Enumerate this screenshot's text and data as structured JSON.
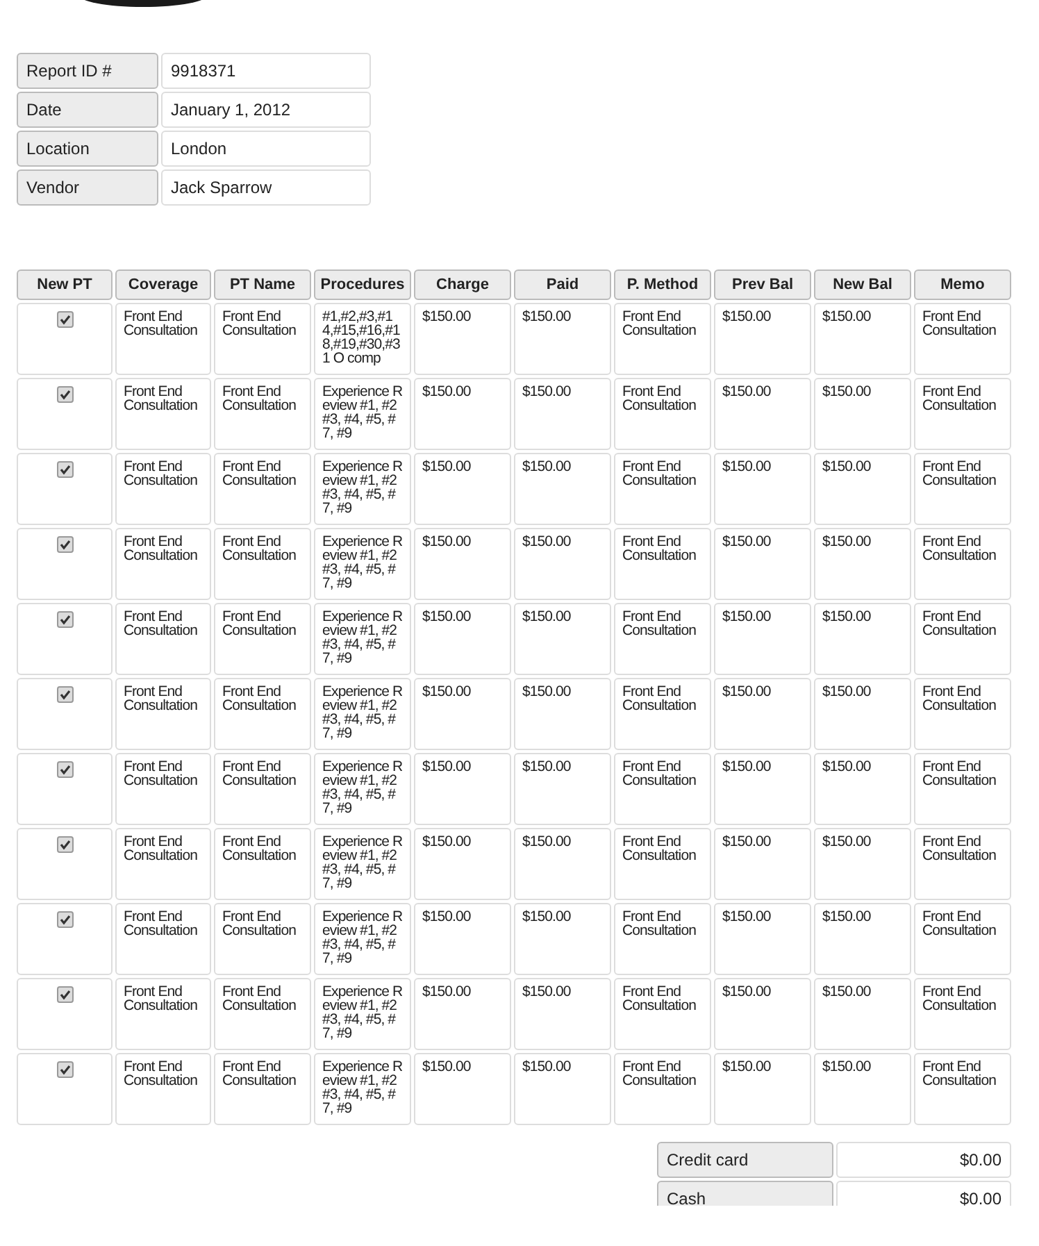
{
  "report_fields": [
    {
      "label": "Report ID #",
      "value": "9918371"
    },
    {
      "label": "Date",
      "value": "January 1, 2012"
    },
    {
      "label": "Location",
      "value": "London"
    },
    {
      "label": "Vendor",
      "value": "Jack Sparrow"
    }
  ],
  "table": {
    "columns": [
      "New PT",
      "Coverage",
      "PT Name",
      "Procedures",
      "Charge",
      "Paid",
      "P. Method",
      "Prev Bal",
      "New Bal",
      "Memo"
    ],
    "rows": [
      {
        "new_pt": true,
        "coverage": "Front End Consultation",
        "pt_name": "Front End Consultation",
        "procedures": "#1,#2,#3,#14,#15,#16,#18,#19,#30,#31 O comp",
        "charge": "$150.00",
        "paid": "$150.00",
        "method": "Front End Consultation",
        "prev_bal": "$150.00",
        "new_bal": "$150.00",
        "memo": "Front End Consultation"
      },
      {
        "new_pt": true,
        "coverage": "Front End Consultation",
        "pt_name": "Front End Consultation",
        "procedures": "Experience Review #1, #2 #3, #4, #5, #7, #9",
        "charge": "$150.00",
        "paid": "$150.00",
        "method": "Front End Consultation",
        "prev_bal": "$150.00",
        "new_bal": "$150.00",
        "memo": "Front End Consultation"
      },
      {
        "new_pt": true,
        "coverage": "Front End Consultation",
        "pt_name": "Front End Consultation",
        "procedures": "Experience Review #1, #2 #3, #4, #5, #7, #9",
        "charge": "$150.00",
        "paid": "$150.00",
        "method": "Front End Consultation",
        "prev_bal": "$150.00",
        "new_bal": "$150.00",
        "memo": "Front End Consultation"
      },
      {
        "new_pt": true,
        "coverage": "Front End Consultation",
        "pt_name": "Front End Consultation",
        "procedures": "Experience Review #1, #2 #3, #4, #5, #7, #9",
        "charge": "$150.00",
        "paid": "$150.00",
        "method": "Front End Consultation",
        "prev_bal": "$150.00",
        "new_bal": "$150.00",
        "memo": "Front End Consultation"
      },
      {
        "new_pt": true,
        "coverage": "Front End Consultation",
        "pt_name": "Front End Consultation",
        "procedures": "Experience Review #1, #2 #3, #4, #5, #7, #9",
        "charge": "$150.00",
        "paid": "$150.00",
        "method": "Front End Consultation",
        "prev_bal": "$150.00",
        "new_bal": "$150.00",
        "memo": "Front End Consultation"
      },
      {
        "new_pt": true,
        "coverage": "Front End Consultation",
        "pt_name": "Front End Consultation",
        "procedures": "Experience Review #1, #2 #3, #4, #5, #7, #9",
        "charge": "$150.00",
        "paid": "$150.00",
        "method": "Front End Consultation",
        "prev_bal": "$150.00",
        "new_bal": "$150.00",
        "memo": "Front End Consultation"
      },
      {
        "new_pt": true,
        "coverage": "Front End Consultation",
        "pt_name": "Front End Consultation",
        "procedures": "Experience Review #1, #2 #3, #4, #5, #7, #9",
        "charge": "$150.00",
        "paid": "$150.00",
        "method": "Front End Consultation",
        "prev_bal": "$150.00",
        "new_bal": "$150.00",
        "memo": "Front End Consultation"
      },
      {
        "new_pt": true,
        "coverage": "Front End Consultation",
        "pt_name": "Front End Consultation",
        "procedures": "Experience Review #1, #2 #3, #4, #5, #7, #9",
        "charge": "$150.00",
        "paid": "$150.00",
        "method": "Front End Consultation",
        "prev_bal": "$150.00",
        "new_bal": "$150.00",
        "memo": "Front End Consultation"
      },
      {
        "new_pt": true,
        "coverage": "Front End Consultation",
        "pt_name": "Front End Consultation",
        "procedures": "Experience Review #1, #2 #3, #4, #5, #7, #9",
        "charge": "$150.00",
        "paid": "$150.00",
        "method": "Front End Consultation",
        "prev_bal": "$150.00",
        "new_bal": "$150.00",
        "memo": "Front End Consultation"
      },
      {
        "new_pt": true,
        "coverage": "Front End Consultation",
        "pt_name": "Front End Consultation",
        "procedures": "Experience Review #1, #2 #3, #4, #5, #7, #9",
        "charge": "$150.00",
        "paid": "$150.00",
        "method": "Front End Consultation",
        "prev_bal": "$150.00",
        "new_bal": "$150.00",
        "memo": "Front End Consultation"
      },
      {
        "new_pt": true,
        "coverage": "Front End Consultation",
        "pt_name": "Front End Consultation",
        "procedures": "Experience Review #1, #2 #3, #4, #5, #7, #9",
        "charge": "$150.00",
        "paid": "$150.00",
        "method": "Front End Consultation",
        "prev_bal": "$150.00",
        "new_bal": "$150.00",
        "memo": "Front End Consultation"
      }
    ]
  },
  "payments": [
    {
      "label": "Credit card",
      "value": "$0.00"
    },
    {
      "label": "Cash",
      "value": "$0.00"
    }
  ]
}
